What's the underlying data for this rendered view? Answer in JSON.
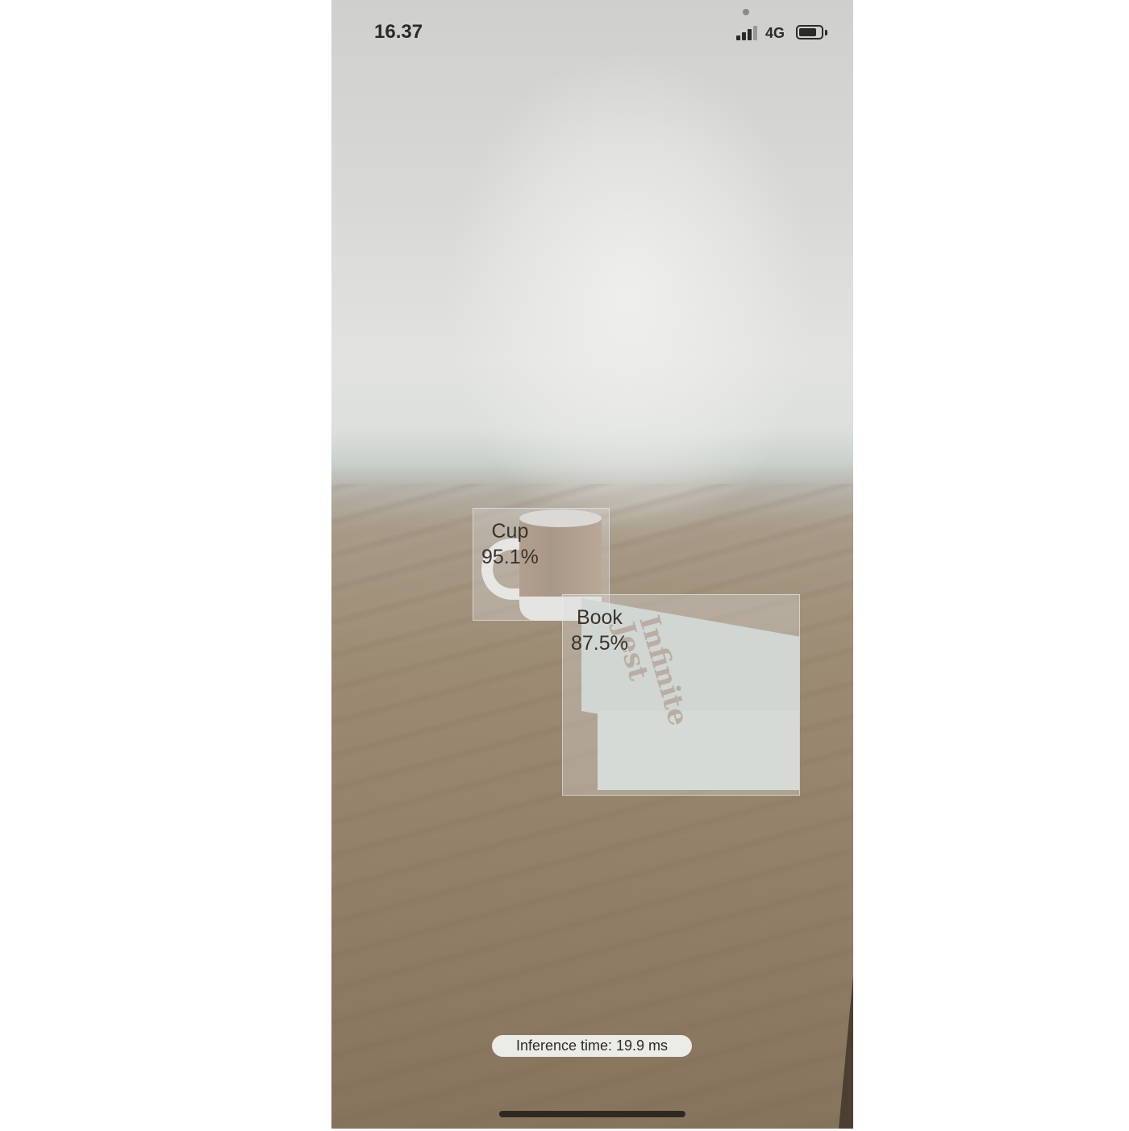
{
  "status_bar": {
    "time": "16.37",
    "network": "4G",
    "signal_bars": 3,
    "battery_level": 0.8,
    "icons": [
      "signal-bars-icon",
      "battery-icon"
    ]
  },
  "scene": {
    "book_title": "Infinite\nJest"
  },
  "detections": [
    {
      "label": "Cup",
      "confidence": "95.1%"
    },
    {
      "label": "Book",
      "confidence": "87.5%"
    }
  ],
  "overlay": {
    "inference_text": "Inference time: 19.9 ms"
  },
  "colors": {
    "text_dark": "#2c2a27",
    "pill_background": "#ebebe8",
    "box_overlay": "#dcdcde"
  }
}
